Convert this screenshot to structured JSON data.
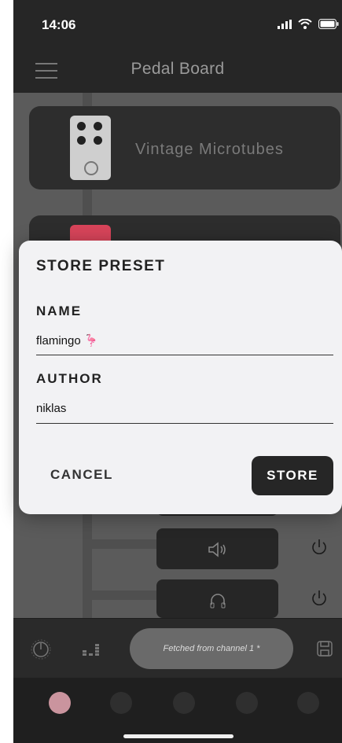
{
  "status": {
    "time": "14:06"
  },
  "nav": {
    "title": "Pedal Board"
  },
  "cards": [
    {
      "label": "Vintage Microtubes",
      "pedal_color": "#cfcfcf"
    },
    {
      "label": "",
      "pedal_color": "#d8445a"
    }
  ],
  "dialog": {
    "title": "STORE PRESET",
    "name_label": "NAME",
    "name_value": "flamingo 🦩",
    "author_label": "AUTHOR",
    "author_value": "niklas",
    "cancel_label": "CANCEL",
    "store_label": "STORE"
  },
  "utility": [
    {
      "icon": "speaker-icon",
      "glyph": "🕪"
    },
    {
      "icon": "headphones-icon",
      "glyph": "🎧"
    }
  ],
  "bottombar": {
    "status_text": "Fetched from channel 1 *",
    "icons": [
      "tuner-knob-icon",
      "level-meter-icon",
      "save-icon"
    ]
  },
  "dock": {
    "dots": 5,
    "active_index": 0,
    "active_color": "#e9a9b5"
  }
}
